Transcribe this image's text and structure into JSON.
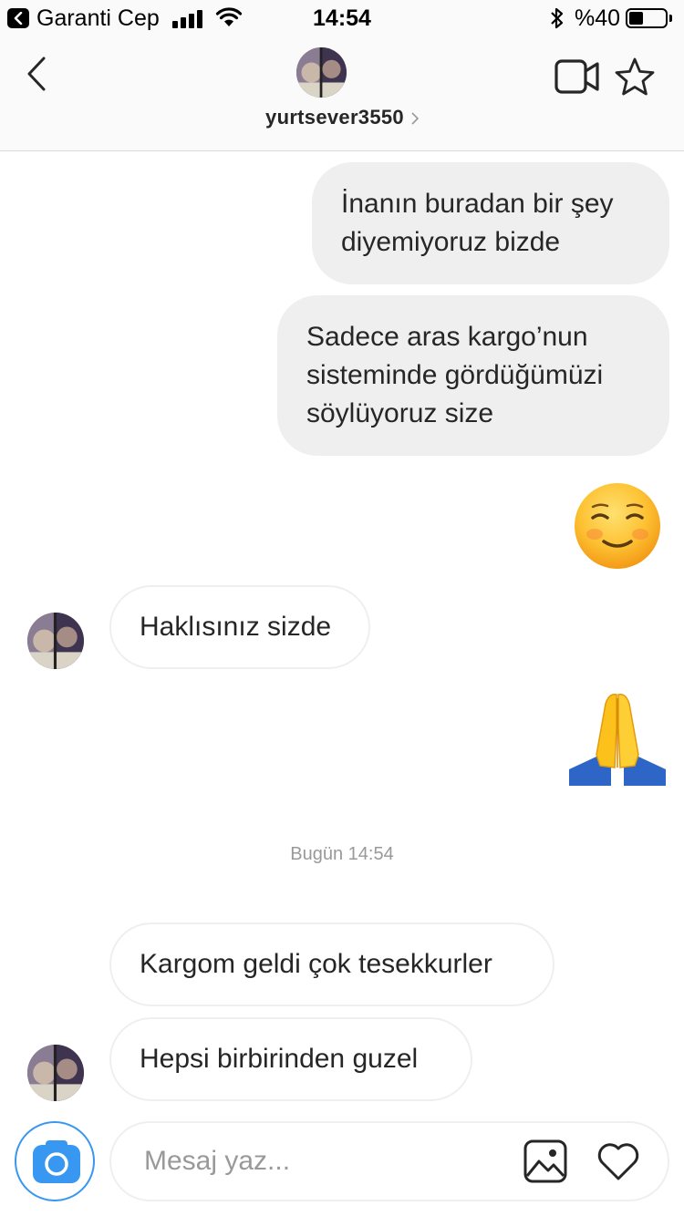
{
  "status_bar": {
    "carrier": "Garanti Cep",
    "time": "14:54",
    "battery_percent": "%40",
    "battery_level": 0.4
  },
  "header": {
    "username": "yurtsever3550",
    "icons": [
      "back-icon",
      "video-call-icon",
      "star-icon",
      "chevron-right-icon"
    ]
  },
  "messages": [
    {
      "direction": "outgoing",
      "text": "İnanın buradan bir şey diyemiyoruz bizde",
      "lines": [
        "İnanın buradan bir şey",
        "diyemiyoruz bizde"
      ]
    },
    {
      "direction": "outgoing",
      "text": "Sadece aras kargo’nun sisteminde gördüğümüzi söylüyoruz size",
      "lines": [
        "Sadece aras kargo’nun",
        "sisteminde gördüğümüzi",
        "söylüyoruz size"
      ]
    },
    {
      "direction": "outgoing",
      "emoji": "☺️",
      "icon": "smiling-face-emoji"
    },
    {
      "direction": "incoming",
      "text": "Haklısınız sizde"
    },
    {
      "direction": "outgoing",
      "emoji": "🙏",
      "icon": "folded-hands-emoji"
    },
    {
      "direction": "incoming",
      "text": "Kargom geldi çok tesekkurler"
    },
    {
      "direction": "incoming",
      "text": "Hepsi birbirinden guzel"
    }
  ],
  "timestamp": "Bugün 14:54",
  "composer": {
    "placeholder": "Mesaj yaz...",
    "icons": [
      "camera-icon",
      "gallery-icon",
      "heart-icon"
    ]
  },
  "colors": {
    "accent": "#3897f0",
    "bubble_out": "#efefef",
    "text": "#262626",
    "muted": "#999999"
  }
}
